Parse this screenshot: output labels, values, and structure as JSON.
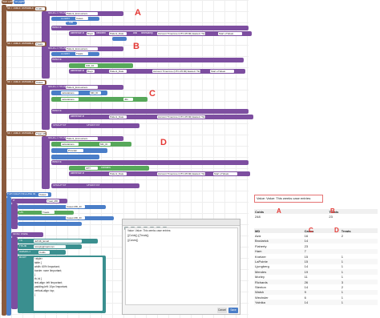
{
  "labels": {
    "a": "A",
    "b": "B",
    "c": "C",
    "d": "D",
    "small_a": "A",
    "small_b": "B",
    "small_c": "C",
    "small_d": "D"
  },
  "blocks": {
    "header_tab_1": "Run Code",
    "header_tab_2": "Go (Ignore)",
    "set_table_1": "SET TABLE VARIABLE",
    "set_table_1_var": "Colds",
    "select_from_1": "SELECT FROM",
    "select_from_1_table": "Patient_Encounters",
    "count_label": "COUNT",
    "count_value": "Cases",
    "add_label": "+ Add",
    "where_label": "WHERE",
    "difference_in": "difference in",
    "days_label": "Days",
    "between_label": "between",
    "field_patient_date": "Patient_Date",
    "and_label": "and",
    "timestamp_label": "timestamp",
    "tz_value": "Account Timezone (UTC-05:00) Eastern Time (US &",
    "start_week": "Start of Week",
    "set_table_2": "SET TABLE VARIABLE",
    "set_table_2_var": "Treats",
    "select_from_2_table": "Patient_Encounters",
    "treats_count": "Treats",
    "field_icd": "ICD_10",
    "field_cpt": "CPT",
    "set_table_3": "SET TABLE VARIABLE",
    "set_table_3_var": "Cases",
    "select_from_3_table": "Patient_Encounters",
    "calculations": "calculations",
    "field_md": "MD_ID",
    "field_code": "J01",
    "group_by": "GROUP BY",
    "order_by": "ORDER BY",
    "set_table_4": "SET TABLE VARIABLE",
    "set_table_4_var": "Treat_MD",
    "select_from_4_table": "Patient_Encounters",
    "field_provider": "Provider",
    "contains_label": "contains",
    "for_each": "FOR EACH RECORD IN",
    "for_each_table": "Cases",
    "if_label": "IF",
    "treat_md_field": "Treat_MD",
    "on_label": "ON",
    "treats_field": "Treats",
    "cases_md": "Cases.MD_ID",
    "send_email": "SEND EMAIL",
    "to_label": "TO",
    "to_value": "Jeff.Mi_Email",
    "from_label": "FROM",
    "from_value": "noreply@mail.com",
    "subject_label": "SUBJECT",
    "subject_value": "Colds",
    "body_label": "BODY",
    "html_1": "<style>",
    "html_2": "table {",
    "html_3": "  width: 60% !important;",
    "html_4": "  border: none !important;",
    "html_5": "}",
    "html_6": "th, td {",
    "html_7": "  text-align: left !important;",
    "html_8": "  padding-left: 10px !important;",
    "html_9": "  vertical-align: top;",
    "html_10": "}"
  },
  "dialog": {
    "line_1": "Value: Value: This weeks case entries:",
    "line_2": "{{Colds}} {{Treats}}",
    "line_3": "{{Cases}}",
    "cancel": "Cancel",
    "save": "Save"
  },
  "result": {
    "value_text": "Value: Value: This weeks case entries:",
    "summary_headers": [
      "Colds",
      "Treats"
    ],
    "summary_values": [
      "248",
      "23"
    ],
    "md_headers": [
      "MD",
      "Cases",
      "Treats"
    ],
    "md_rows": [
      [
        "Aziz",
        "16",
        "2"
      ],
      [
        "Brodarick",
        "14",
        ""
      ],
      [
        "Flaherty",
        "23",
        ""
      ],
      [
        "Ham",
        "7",
        ""
      ],
      [
        "Knetzer",
        "15",
        "1"
      ],
      [
        "LaPointe",
        "15",
        "1"
      ],
      [
        "Ljungberg",
        "14",
        "1"
      ],
      [
        "Mendes",
        "19",
        "1"
      ],
      [
        "Morley",
        "11",
        "1"
      ],
      [
        "Richards",
        "26",
        "3"
      ],
      [
        "Stenton",
        "14",
        "2"
      ],
      [
        "Walsh",
        "9",
        "1"
      ],
      [
        "Wechsler",
        "6",
        "1"
      ],
      [
        "Yalnika",
        "14",
        "1"
      ]
    ]
  },
  "colors": {
    "brown": "#8a5a3c",
    "purple": "#7d4ea0",
    "blue": "#4a7ec8",
    "teal": "#3a8f8f",
    "green": "#57a85a",
    "red": "#e53935",
    "gray": "#9e9e9e"
  }
}
